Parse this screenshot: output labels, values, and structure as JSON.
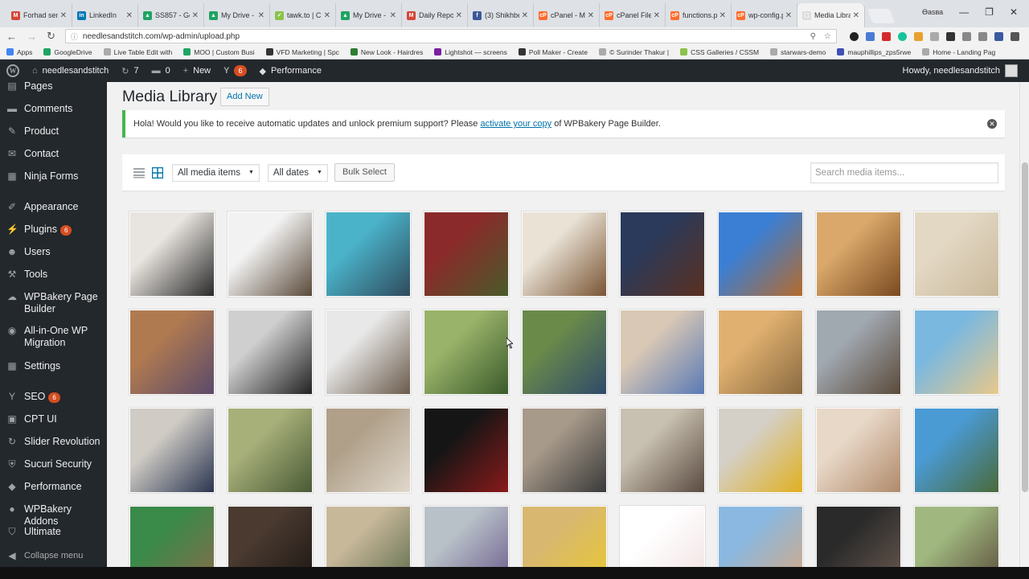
{
  "browser": {
    "tabs": [
      {
        "label": "Forhad sent",
        "fav": "#d44638",
        "glyph": "M"
      },
      {
        "label": "LinkedIn",
        "fav": "#0077b5",
        "glyph": "in"
      },
      {
        "label": "SS857 - Goo",
        "fav": "#1fa463",
        "glyph": "▲"
      },
      {
        "label": "My Drive - G",
        "fav": "#1fa463",
        "glyph": "▲"
      },
      {
        "label": "tawk.to | Ch",
        "fav": "#8bc34a",
        "glyph": "✓"
      },
      {
        "label": "My Drive - G",
        "fav": "#1fa463",
        "glyph": "▲"
      },
      {
        "label": "Daily Repor",
        "fav": "#d44638",
        "glyph": "M"
      },
      {
        "label": "(3) Shikhbe",
        "fav": "#3b5998",
        "glyph": "f"
      },
      {
        "label": "cPanel - Ma",
        "fav": "#ff6c2c",
        "glyph": "cP"
      },
      {
        "label": "cPanel File M",
        "fav": "#ff6c2c",
        "glyph": "cP"
      },
      {
        "label": "functions.ph",
        "fav": "#ff6c2c",
        "glyph": "cP"
      },
      {
        "label": "wp-config.p",
        "fav": "#ff6c2c",
        "glyph": "cP"
      },
      {
        "label": "Media Libra",
        "fav": "#dddddd",
        "glyph": "▢",
        "active": true
      }
    ],
    "window_label": "Ѳаѕва",
    "url": "needlesandstitch.com/wp-admin/upload.php",
    "bookmarks": [
      {
        "label": "Apps",
        "color": "#4285f4"
      },
      {
        "label": "GoogleDrive",
        "color": "#1fa463"
      },
      {
        "label": "Live Table Edit with",
        "color": "#aaaaaa"
      },
      {
        "label": "MOO | Custom Busi",
        "color": "#1fa463"
      },
      {
        "label": "VFD Marketing | Spc",
        "color": "#333333"
      },
      {
        "label": "New Look - Hairdres",
        "color": "#2e7d32"
      },
      {
        "label": "Lightshot — screens",
        "color": "#7b1fa2"
      },
      {
        "label": "Poll Maker - Create",
        "color": "#333333"
      },
      {
        "label": "© Surinder Thakur |",
        "color": "#aaaaaa"
      },
      {
        "label": "CSS Galleries / CSSM",
        "color": "#8bc34a"
      },
      {
        "label": "starwars-demo",
        "color": "#aaaaaa"
      },
      {
        "label": "mauphillips_zps5rwe",
        "color": "#3f51b5"
      },
      {
        "label": "Home - Landing Pag",
        "color": "#aaaaaa"
      }
    ]
  },
  "adminbar": {
    "site": "needlesandstitch",
    "updates": "7",
    "comments": "0",
    "new_label": "New",
    "seo_badge": "6",
    "performance": "Performance",
    "howdy": "Howdy, needlesandstitch"
  },
  "sidebar": {
    "items": [
      {
        "label": "Pages",
        "icon": "pages-icon",
        "glyph": "▤"
      },
      {
        "label": "Comments",
        "icon": "comments-icon",
        "glyph": "▬"
      },
      {
        "label": "Product",
        "icon": "pin-icon",
        "glyph": "✎"
      },
      {
        "label": "Contact",
        "icon": "mail-icon",
        "glyph": "✉"
      },
      {
        "label": "Ninja Forms",
        "icon": "forms-icon",
        "glyph": "▦"
      },
      {
        "label": "Appearance",
        "icon": "brush-icon",
        "glyph": "✐"
      },
      {
        "label": "Plugins",
        "icon": "plugin-icon",
        "glyph": "⚡",
        "badge": "6"
      },
      {
        "label": "Users",
        "icon": "users-icon",
        "glyph": "☻"
      },
      {
        "label": "Tools",
        "icon": "wrench-icon",
        "glyph": "⚒"
      },
      {
        "label": "WPBakery Page Builder",
        "icon": "wpbakery-icon",
        "glyph": "☁"
      },
      {
        "label": "All-in-One WP Migration",
        "icon": "migration-icon",
        "glyph": "◉"
      },
      {
        "label": "Settings",
        "icon": "settings-icon",
        "glyph": "▦"
      },
      {
        "label": "SEO",
        "icon": "seo-icon",
        "glyph": "Y",
        "badge": "6"
      },
      {
        "label": "CPT UI",
        "icon": "cpt-icon",
        "glyph": "▣"
      },
      {
        "label": "Slider Revolution",
        "icon": "slider-icon",
        "glyph": "↻"
      },
      {
        "label": "Sucuri Security",
        "icon": "shield-icon",
        "glyph": "⛨"
      },
      {
        "label": "Performance",
        "icon": "performance-icon",
        "glyph": "◆"
      },
      {
        "label": "WPBakery Addons",
        "icon": "addons-icon",
        "glyph": "●"
      },
      {
        "label": "Ultimate",
        "icon": "ultimate-icon",
        "glyph": "⛉"
      },
      {
        "label": "Collapse menu",
        "icon": "collapse-icon",
        "glyph": "◀"
      }
    ]
  },
  "main": {
    "title": "Media Library",
    "add_new": "Add New",
    "notice_before": "Hola! Would you like to receive automatic updates and unlock premium support? Please ",
    "notice_link": "activate your copy",
    "notice_after": " of WPBakery Page Builder.",
    "filter_type": "All media items",
    "filter_date": "All dates",
    "bulk_select": "Bulk Select",
    "search_placeholder": "Search media items..."
  },
  "media": [
    {
      "alt": "leather wallet",
      "c1": "#e8e4df",
      "c2": "#2a2a2a"
    },
    {
      "alt": "sunglasses and watch",
      "c1": "#f2f2f2",
      "c2": "#5a4a3a"
    },
    {
      "alt": "woman on train platform",
      "c1": "#4ab3c9",
      "c2": "#2f4a5c"
    },
    {
      "alt": "sandals on grass",
      "c1": "#8b2a2a",
      "c2": "#4a5a2a"
    },
    {
      "alt": "brown hat",
      "c1": "#e9e2d5",
      "c2": "#7a5535"
    },
    {
      "alt": "belt buckle jeans",
      "c1": "#2b3a5a",
      "c2": "#5a3020"
    },
    {
      "alt": "leather bag",
      "c1": "#3a7fd4",
      "c2": "#b56b2c"
    },
    {
      "alt": "leather tool bag",
      "c1": "#d9a86a",
      "c2": "#7a4a20"
    },
    {
      "alt": "pearl necklace",
      "c1": "#e3d8c4",
      "c2": "#c9b89a"
    },
    {
      "alt": "market stall",
      "c1": "#b07a50",
      "c2": "#5a4a6a"
    },
    {
      "alt": "person with bag",
      "c1": "#cfcfcf",
      "c2": "#222222"
    },
    {
      "alt": "fern and feet",
      "c1": "#e8e8e8",
      "c2": "#6a5a4a"
    },
    {
      "alt": "woman gardening",
      "c1": "#9ab36a",
      "c2": "#3a5a2a"
    },
    {
      "alt": "bearded man garden",
      "c1": "#6a8a4a",
      "c2": "#2f4a6a"
    },
    {
      "alt": "couple laughing",
      "c1": "#d9c8b5",
      "c2": "#5a7ab5"
    },
    {
      "alt": "father and child",
      "c1": "#e0b070",
      "c2": "#8a6a40"
    },
    {
      "alt": "group of friends",
      "c1": "#a0a8b0",
      "c2": "#5a4a3a"
    },
    {
      "alt": "friends at beach",
      "c1": "#7ab8e0",
      "c2": "#e8c88a"
    },
    {
      "alt": "man in denim jacket",
      "c1": "#d0ccc5",
      "c2": "#2a3550"
    },
    {
      "alt": "woman with rifle",
      "c1": "#a8b07a",
      "c2": "#4a5a35"
    },
    {
      "alt": "shopping bags",
      "c1": "#b0a08a",
      "c2": "#e0d8cc"
    },
    {
      "alt": "sneakers on red box",
      "c1": "#151515",
      "c2": "#8a1a1a"
    },
    {
      "alt": "woman sitting by fence",
      "c1": "#a89a8a",
      "c2": "#3a3a3a"
    },
    {
      "alt": "couple in alley",
      "c1": "#c8c0b0",
      "c2": "#5a4a40"
    },
    {
      "alt": "woman yellow jacket",
      "c1": "#d4d0c8",
      "c2": "#e0b020"
    },
    {
      "alt": "woman sitting on steps",
      "c1": "#e8d8c8",
      "c2": "#b08a6a"
    },
    {
      "alt": "woman in field",
      "c1": "#4a9ad4",
      "c2": "#4a6a3a"
    },
    {
      "alt": "boats on river",
      "c1": "#3a8a4a",
      "c2": "#8a6a4a"
    },
    {
      "alt": "woman portrait dark",
      "c1": "#4a3a30",
      "c2": "#1a1512"
    },
    {
      "alt": "cyclist",
      "c1": "#c8b89a",
      "c2": "#5a6a4a"
    },
    {
      "alt": "man on phone",
      "c1": "#b8c0c8",
      "c2": "#6a5a8a"
    },
    {
      "alt": "woman yellow dress bamboo",
      "c1": "#d8b870",
      "c2": "#e8c830"
    },
    {
      "alt": "vendor selection diagram",
      "c1": "#ffffff",
      "c2": "#f0e0e0"
    },
    {
      "alt": "smiling man",
      "c1": "#8ab8e0",
      "c2": "#d8a880"
    },
    {
      "alt": "man portrait dark",
      "c1": "#2a2a2a",
      "c2": "#6a5a50"
    },
    {
      "alt": "people outdoors",
      "c1": "#a0b880",
      "c2": "#5a4a3a"
    }
  ]
}
